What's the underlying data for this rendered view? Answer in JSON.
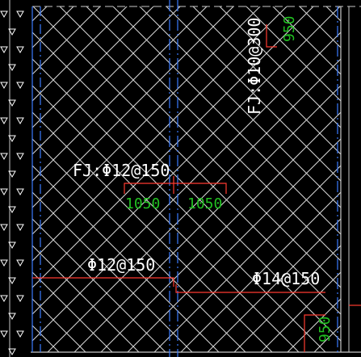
{
  "drawing": {
    "colors": {
      "background": "#000000",
      "hatch": "#d9d9d9",
      "axis": "#3a7bff",
      "rebar": "#ff3b30",
      "label": "#ffffff",
      "dimension": "#21c021",
      "border": "#c8c8c8",
      "wall": "#ffffff"
    },
    "labels": {
      "fj_top_right": "FJ:Φ10@300",
      "fj_mid": "FJ:Φ12@150",
      "bar_left": "Φ12@150",
      "bar_right": "Φ14@150"
    },
    "dimensions": {
      "top_right": "950",
      "mid_left": "1050",
      "mid_right": "1050",
      "bottom_right": "950"
    }
  }
}
